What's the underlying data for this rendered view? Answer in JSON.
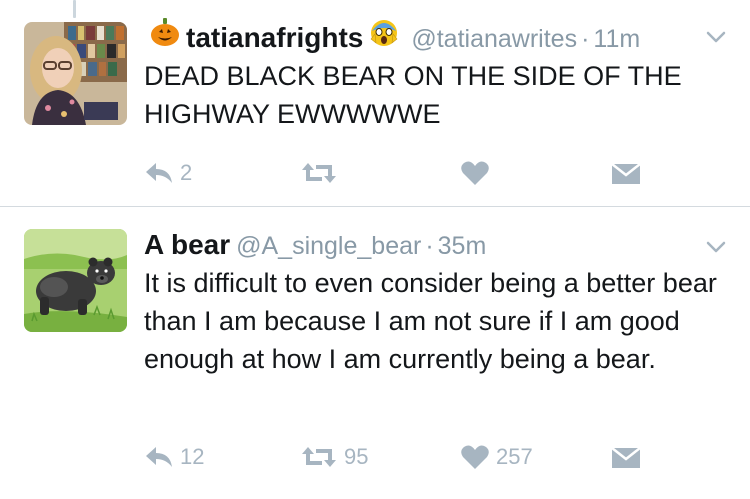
{
  "tweets": [
    {
      "display_name": "tatianafrights",
      "name_prefix_icon": "jack-o-lantern-emoji",
      "name_suffix_icon": "screaming-face-emoji",
      "handle": "@tatianawrites",
      "separator": "·",
      "time": "11m",
      "text": "DEAD BLACK BEAR ON THE SIDE OF THE HIGHWAY EWWWWWE",
      "reply_count": "2",
      "retweet_count": "",
      "like_count": ""
    },
    {
      "display_name": "A bear",
      "handle": "@A_single_bear",
      "separator": "·",
      "time": "35m",
      "text": "It is difficult to even consider being a better bear than I am because I am not sure if I am good enough at how I am currently being a bear.",
      "reply_count": "12",
      "retweet_count": "95",
      "like_count": "257"
    }
  ],
  "icons": {
    "reply": "reply-icon",
    "retweet": "retweet-icon",
    "like": "heart-icon",
    "dm": "envelope-icon",
    "menu": "chevron-down-icon"
  },
  "colors": {
    "text": "#14171a",
    "secondary": "#8899a6",
    "action": "#a7b5c1",
    "divider": "#d4dadf"
  }
}
